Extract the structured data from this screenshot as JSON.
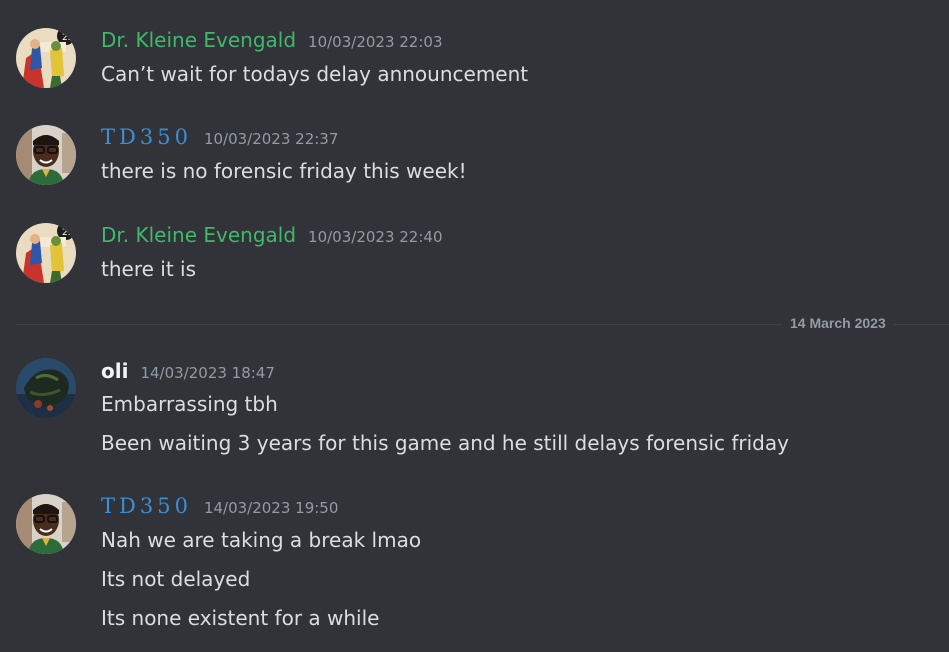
{
  "colors": {
    "background": "#313338",
    "username_green": "#3fb96a",
    "username_blue": "#3b8fd6",
    "text": "#dbdee1",
    "timestamp": "#949ba4"
  },
  "messages": [
    {
      "author": "Dr. Kleine Evengald",
      "timestamp": "10/03/2023 22:03",
      "avatar_icon": "comic-cover-avatar-icon",
      "lines": [
        "Can’t wait for todays delay announcement"
      ]
    },
    {
      "author": "TD350",
      "timestamp": "10/03/2023 22:37",
      "avatar_icon": "person-glasses-avatar-icon",
      "lines": [
        "there is no forensic friday this week!"
      ]
    },
    {
      "author": "Dr. Kleine Evengald",
      "timestamp": "10/03/2023 22:40",
      "avatar_icon": "comic-cover-avatar-icon",
      "lines": [
        "there it is"
      ]
    },
    {
      "author": "oli",
      "timestamp": "14/03/2023 18:47",
      "avatar_icon": "dark-creature-avatar-icon",
      "lines": [
        "Embarrassing tbh",
        "Been waiting 3 years for this game and he still delays forensic friday"
      ]
    },
    {
      "author": "TD350",
      "timestamp": "14/03/2023 19:50",
      "avatar_icon": "person-glasses-avatar-icon",
      "lines": [
        "Nah we are taking a break lmao",
        "Its not delayed",
        "Its none existent for a while"
      ]
    }
  ],
  "date_divider": "14 March 2023"
}
